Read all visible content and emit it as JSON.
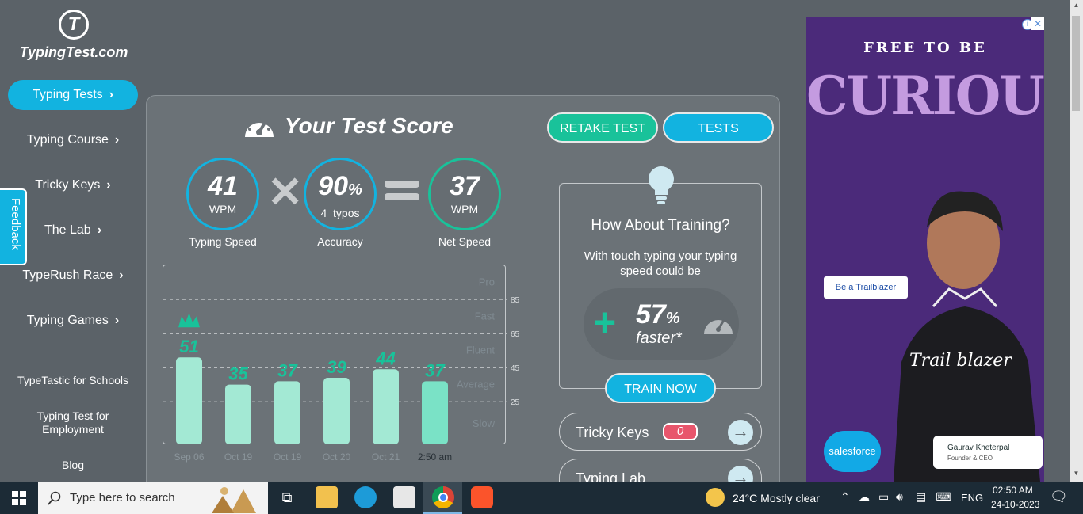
{
  "brand": {
    "name": "TypingTest.com",
    "mark": "T"
  },
  "sidebar": {
    "items": [
      {
        "label": "Typing Tests"
      },
      {
        "label": "Typing Course"
      },
      {
        "label": "Tricky Keys"
      },
      {
        "label": "The Lab"
      },
      {
        "label": "TypeRush Race"
      },
      {
        "label": "Typing Games"
      }
    ],
    "links": [
      {
        "label": "TypeTastic for Schools"
      },
      {
        "label": "Typing Test for Employment"
      },
      {
        "label": "Blog"
      }
    ],
    "feedback": "Feedback"
  },
  "score": {
    "title": "Your Test Score",
    "retake": "RETAKE TEST",
    "tests": "TESTS",
    "speed": {
      "value": "41",
      "unit": "WPM",
      "label": "Typing Speed"
    },
    "accuracy": {
      "value": "90",
      "unit": "%",
      "typos_count": "4",
      "typos_label": "typos",
      "label": "Accuracy"
    },
    "net": {
      "value": "37",
      "unit": "WPM",
      "label": "Net Speed"
    }
  },
  "chart_data": {
    "type": "bar",
    "categories": [
      "Sep 06",
      "Oct 19",
      "Oct 19",
      "Oct 20",
      "Oct 21",
      "2:50 am"
    ],
    "values": [
      51,
      35,
      37,
      39,
      44,
      37
    ],
    "highlight_index": 5,
    "best_index": 0,
    "ylim": [
      0,
      105
    ],
    "right_ticks": [
      25,
      45,
      65,
      85
    ],
    "bands": [
      "Pro",
      "Fast",
      "Fluent",
      "Average",
      "Slow"
    ],
    "colors": {
      "bar": "#a3e9d4",
      "bar_current": "#7ae2c6",
      "label": "#19c29a"
    }
  },
  "training": {
    "title": "How About Training?",
    "subtitle": "With touch typing your typing speed could be",
    "percent": "57",
    "percent_unit": "%",
    "faster": "faster*",
    "button": "TRAIN NOW"
  },
  "rows": [
    {
      "label": "Tricky Keys",
      "badge": "0"
    },
    {
      "label": "Typing Lab"
    }
  ],
  "ad": {
    "headline_top": "FREE TO BE",
    "headline": "CURIOUS",
    "button": "Be a Trailblazer",
    "shirt_text": "Trail blazer",
    "logo": "salesforce",
    "person_name": "Gaurav Kheterpal",
    "person_role": "Founder & CEO"
  },
  "taskbar": {
    "search_placeholder": "Type here to search",
    "weather": "24°C  Mostly clear",
    "language": "ENG",
    "time": "02:50 AM",
    "date": "24-10-2023"
  }
}
